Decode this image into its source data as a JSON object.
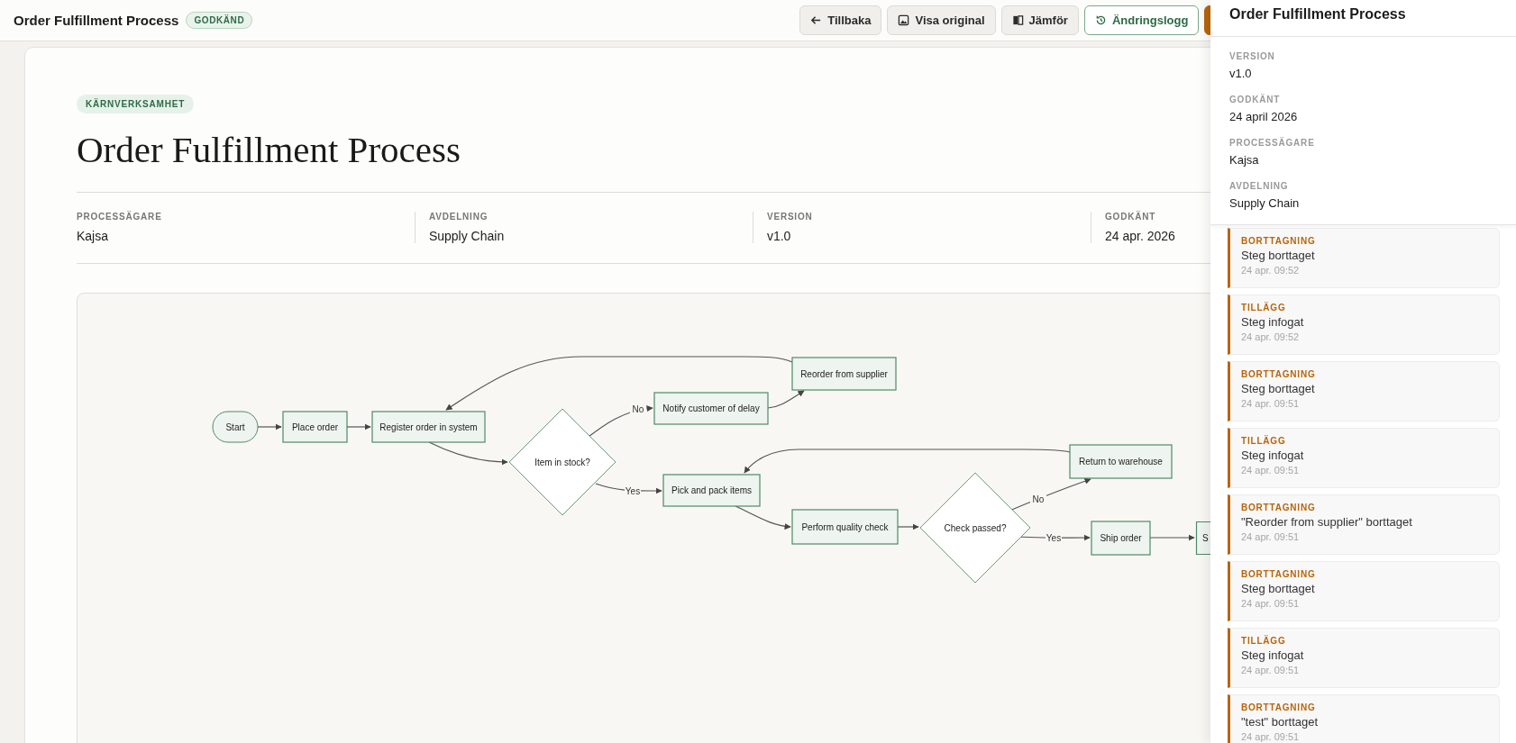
{
  "header": {
    "title": "Order Fulfillment Process",
    "status": "GODKÄND"
  },
  "toolbar": [
    {
      "label": "Tillbaka",
      "selected": false
    },
    {
      "label": "Visa original",
      "selected": false
    },
    {
      "label": "Jämför",
      "selected": false
    },
    {
      "label": "Ändringslogg",
      "selected": true
    }
  ],
  "document": {
    "category": "KÄRNVERKSAMHET",
    "title": "Order Fulfillment Process",
    "meta": [
      {
        "label": "PROCESSÄGARE",
        "value": "Kajsa"
      },
      {
        "label": "AVDELNING",
        "value": "Supply Chain"
      },
      {
        "label": "VERSION",
        "value": "v1.0"
      },
      {
        "label": "GODKÄNT",
        "value": "24 apr. 2026"
      }
    ]
  },
  "flowchart": {
    "nodes": [
      {
        "label": "Start",
        "kind": "terminal"
      },
      {
        "label": "Place order",
        "kind": "process"
      },
      {
        "label": "Register order in system",
        "kind": "process"
      },
      {
        "label": "Item in stock?",
        "kind": "decision"
      },
      {
        "label": "Notify customer of delay",
        "kind": "process"
      },
      {
        "label": "Reorder from supplier",
        "kind": "process"
      },
      {
        "label": "Pick and pack items",
        "kind": "process"
      },
      {
        "label": "Perform quality check",
        "kind": "process"
      },
      {
        "label": "Check passed?",
        "kind": "decision"
      },
      {
        "label": "Return to warehouse",
        "kind": "process"
      },
      {
        "label": "Ship order",
        "kind": "process"
      },
      {
        "label": "S",
        "kind": "process"
      }
    ],
    "edge_labels": [
      "No",
      "Yes",
      "No",
      "Yes"
    ]
  },
  "panel": {
    "title": "Order Fulfillment Process",
    "details": [
      {
        "label": "VERSION",
        "value": "v1.0"
      },
      {
        "label": "GODKÄNT",
        "value": "24 april 2026"
      },
      {
        "label": "PROCESSÄGARE",
        "value": "Kajsa"
      },
      {
        "label": "AVDELNING",
        "value": "Supply Chain"
      }
    ],
    "changes": [
      {
        "type": "BORTTAGNING",
        "text": "Steg borttaget",
        "time": "24 apr. 09:52"
      },
      {
        "type": "TILLÄGG",
        "text": "Steg infogat",
        "time": "24 apr. 09:52"
      },
      {
        "type": "BORTTAGNING",
        "text": "Steg borttaget",
        "time": "24 apr. 09:51"
      },
      {
        "type": "TILLÄGG",
        "text": "Steg infogat",
        "time": "24 apr. 09:51"
      },
      {
        "type": "BORTTAGNING",
        "text": "\"Reorder from supplier\" borttaget",
        "time": "24 apr. 09:51"
      },
      {
        "type": "BORTTAGNING",
        "text": "Steg borttaget",
        "time": "24 apr. 09:51"
      },
      {
        "type": "TILLÄGG",
        "text": "Steg infogat",
        "time": "24 apr. 09:51"
      },
      {
        "type": "BORTTAGNING",
        "text": "\"test\" borttaget",
        "time": "24 apr. 09:51"
      }
    ]
  }
}
